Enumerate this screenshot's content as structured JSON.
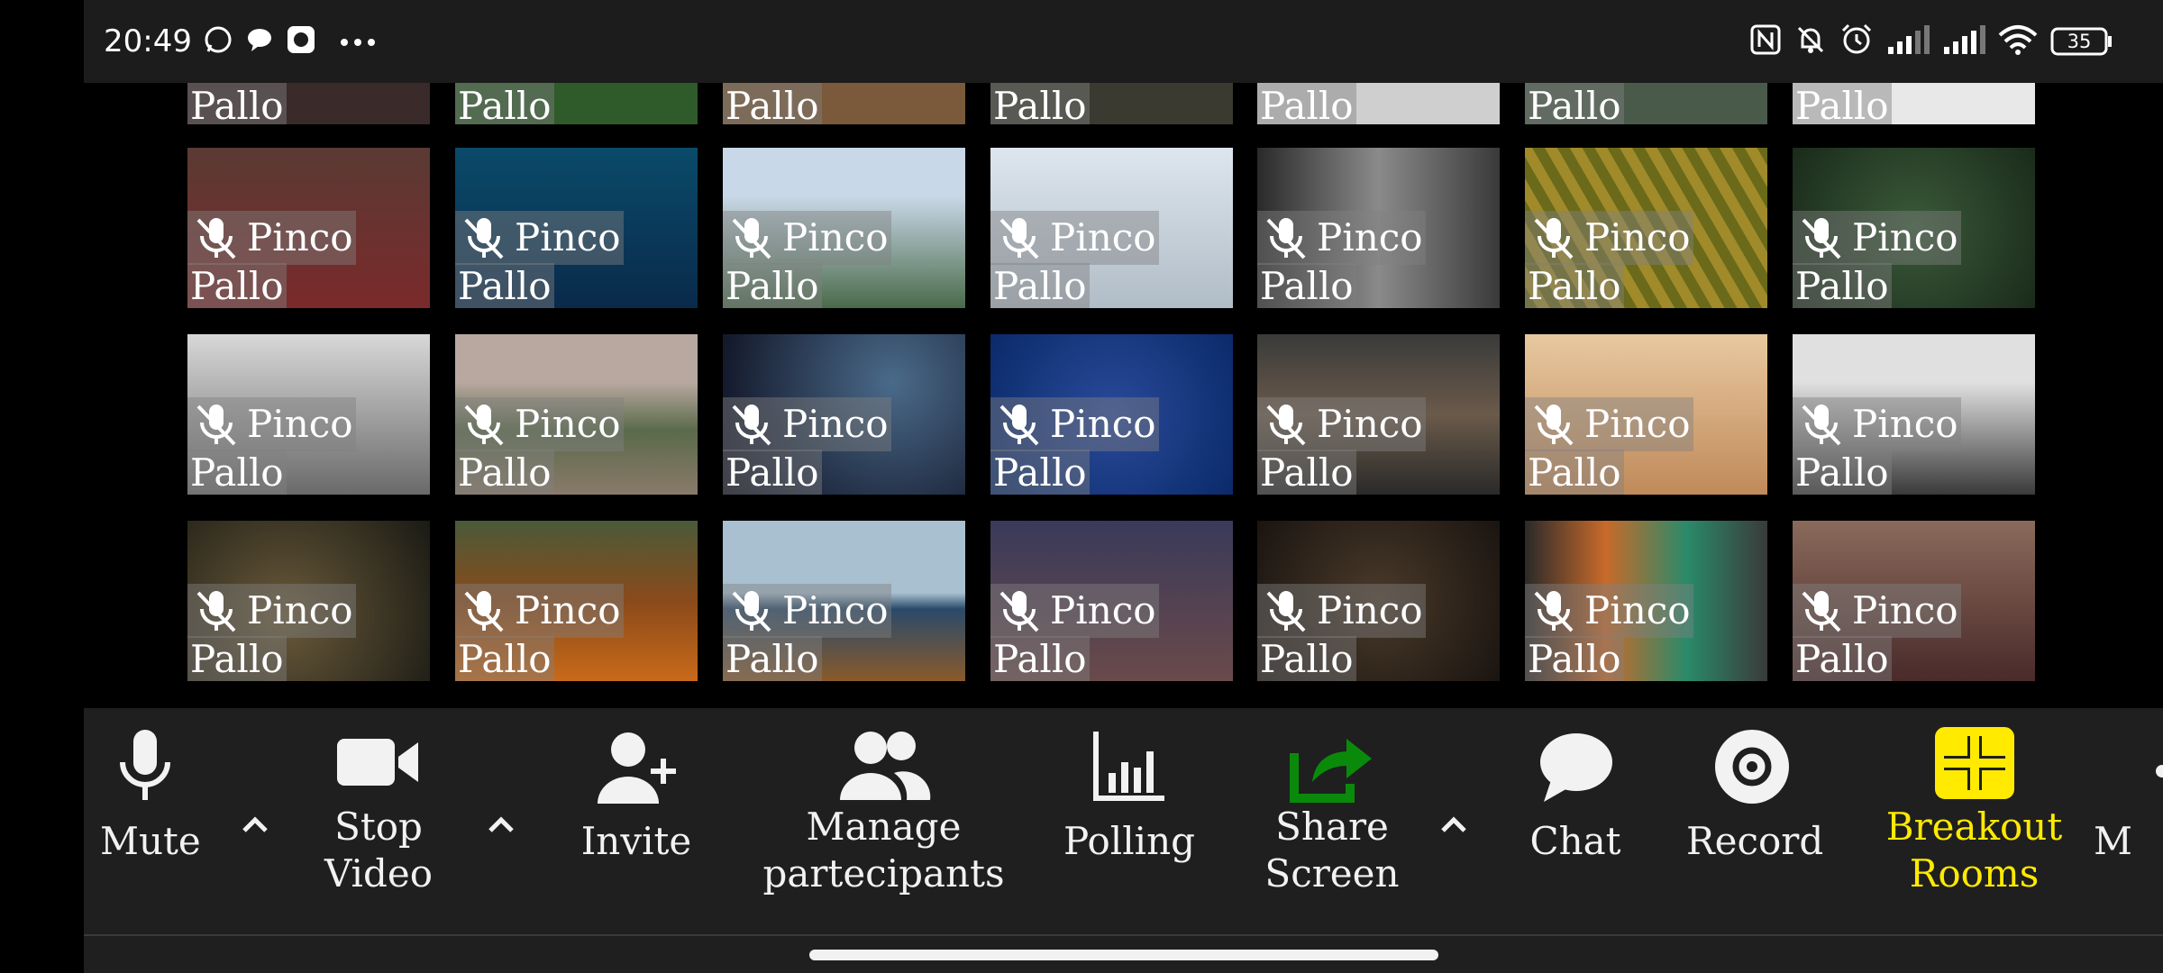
{
  "status_bar": {
    "time": "20:49",
    "battery": "35",
    "left_icons": [
      "whatsapp-icon",
      "chat-bubble-icon",
      "app-icon",
      "more-dots-icon"
    ],
    "right_icons": [
      "nfc-icon",
      "muted-bell-icon",
      "alarm-icon",
      "signal-icon",
      "signal-icon",
      "wifi-icon",
      "battery-icon"
    ]
  },
  "participants": {
    "first_name": "Pinco",
    "last_name": "Pallo",
    "mic_state": "muted"
  },
  "toolbar": {
    "mute_label": "Mute",
    "stop_video_label_1": "Stop",
    "stop_video_label_2": "Video",
    "invite_label": "Invite",
    "manage_label_1": "Manage",
    "manage_label_2": "partecipants",
    "polling_label": "Polling",
    "share_label_1": "Share",
    "share_label_2": "Screen",
    "chat_label": "Chat",
    "record_label": "Record",
    "breakout_label_1": "Breakout",
    "breakout_label_2": "Rooms",
    "more_label": "M"
  },
  "colors": {
    "toolbar_bg": "#1f1f1f",
    "share_accent": "#0a8a0a",
    "breakout_accent": "#ffea00",
    "text": "#f2f2f2"
  }
}
